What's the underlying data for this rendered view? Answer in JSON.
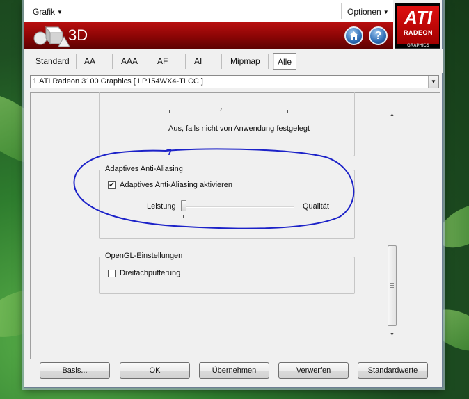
{
  "menubar": {
    "grafik_label": "Grafik",
    "optionen_label": "Optionen"
  },
  "header": {
    "title": "3D",
    "ati_logo_text": "ATI",
    "ati_radeon_text": "RADEON",
    "ati_graphics_text": "GRAPHICS"
  },
  "tabs": [
    {
      "label": "Standard"
    },
    {
      "label": "AA"
    },
    {
      "label": "AAA"
    },
    {
      "label": "AF"
    },
    {
      "label": "AI"
    },
    {
      "label": "Mipmap"
    },
    {
      "label": "Alle"
    }
  ],
  "gpu_selector": {
    "value": "1.ATI Radeon 3100 Graphics [ LP154WX4-TLCC ]"
  },
  "panel": {
    "top_group_note": "Aus, falls nicht von Anwendung festgelegt",
    "adaptive_aa": {
      "title": "Adaptives Anti-Aliasing",
      "checkbox_label": "Adaptives Anti-Aliasing aktivieren",
      "checked": true,
      "slider_left_label": "Leistung",
      "slider_right_label": "Qualität",
      "slider_value": 0
    },
    "opengl": {
      "title": "OpenGL-Einstellungen",
      "checkbox_label": "Dreifachpufferung",
      "checked": false
    }
  },
  "footer": {
    "basis_label": "Basis...",
    "ok_label": "OK",
    "uebernehmen_label": "Übernehmen",
    "verwerfen_label": "Verwerfen",
    "standardwerte_label": "Standardwerte"
  },
  "colors": {
    "header_red": "#8a0505",
    "annotation_blue": "#1c22c8"
  }
}
